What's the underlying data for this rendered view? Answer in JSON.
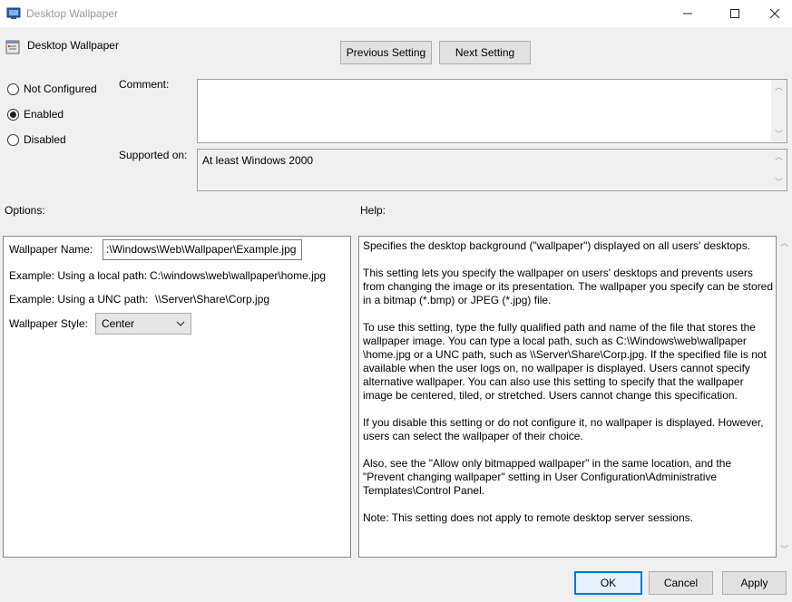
{
  "window": {
    "title": "Desktop Wallpaper"
  },
  "header": {
    "policy_title": "Desktop Wallpaper",
    "previous_label": "Previous Setting",
    "next_label": "Next Setting"
  },
  "state": {
    "options": [
      "Not Configured",
      "Enabled",
      "Disabled"
    ],
    "selected": "Enabled"
  },
  "comment": {
    "label": "Comment:",
    "value": ""
  },
  "supported": {
    "label": "Supported on:",
    "value": "At least Windows 2000"
  },
  "options_section": {
    "label": "Options:",
    "wallpaper_name_label": "Wallpaper Name:",
    "wallpaper_name_value": ":\\Windows\\Web\\Wallpaper\\Example.jpg",
    "example_local_label": "Example: Using a local path:",
    "example_local_value": "C:\\windows\\web\\wallpaper\\home.jpg",
    "example_unc_label": "Example: Using a UNC path:",
    "example_unc_value": "\\\\Server\\Share\\Corp.jpg",
    "style_label": "Wallpaper Style:",
    "style_value": "Center"
  },
  "help_section": {
    "label": "Help:",
    "paragraphs": [
      "Specifies the desktop background (\"wallpaper\") displayed on all users' desktops.",
      "This setting lets you specify the wallpaper on users' desktops and prevents users from changing the image or its presentation. The wallpaper you specify can be stored in a bitmap (*.bmp) or JPEG (*.jpg) file.",
      "To use this setting, type the fully qualified path and name of the file that stores the wallpaper image. You can type a local path, such as C:\\Windows\\web\\wallpaper \\home.jpg or a UNC path, such as \\\\Server\\Share\\Corp.jpg. If the specified file is not available when the user logs on, no wallpaper is displayed. Users cannot specify alternative wallpaper. You can also use this setting to specify that the wallpaper image be centered, tiled, or stretched. Users cannot change this specification.",
      "If you disable this setting or do not configure it, no wallpaper is displayed. However, users can select the wallpaper of their choice.",
      "Also, see the \"Allow only bitmapped wallpaper\" in the same location, and the \"Prevent changing wallpaper\" setting in User Configuration\\Administrative Templates\\Control Panel.",
      "Note: This setting does not apply to remote desktop server sessions."
    ]
  },
  "footer": {
    "ok_label": "OK",
    "cancel_label": "Cancel",
    "apply_label": "Apply"
  },
  "colors": {
    "accent": "#0078d7",
    "window_bg": "#f0f0f0"
  }
}
